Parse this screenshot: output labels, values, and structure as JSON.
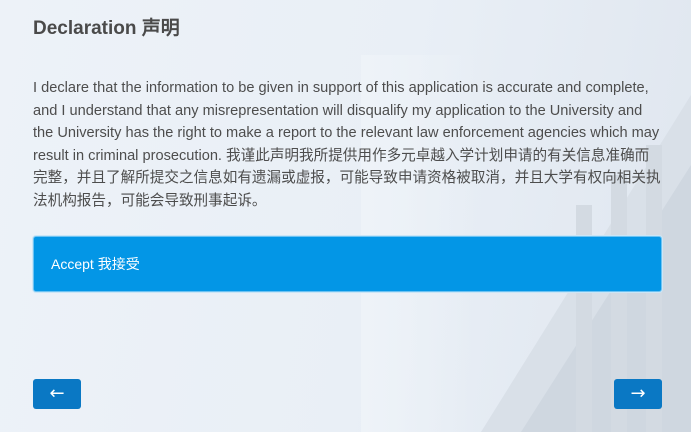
{
  "declaration": {
    "title": "Declaration 声明",
    "text": "I declare that the information to be given in support of this application is accurate and complete, and I understand that any misrepresentation will disqualify my application to the University and the University has the right to make a report to the relevant law enforcement agencies which may result in criminal prosecution. 我谨此声明我所提供用作多元卓越入学计划申请的有关信息准确而完整，并且了解所提交之信息如有遗漏或虚报，可能导致申请资格被取消，并且大学有权向相关执法机构报告，可能会导致刑事起诉。",
    "accept_label": "Accept 我接受"
  },
  "nav": {
    "back_icon": "arrow-left-icon",
    "back_label": "←",
    "next_icon": "arrow-right-icon",
    "next_label": "→"
  },
  "colors": {
    "accent": "#0396e6",
    "nav_button": "#0a78c4",
    "text": "#4a4a4a"
  }
}
